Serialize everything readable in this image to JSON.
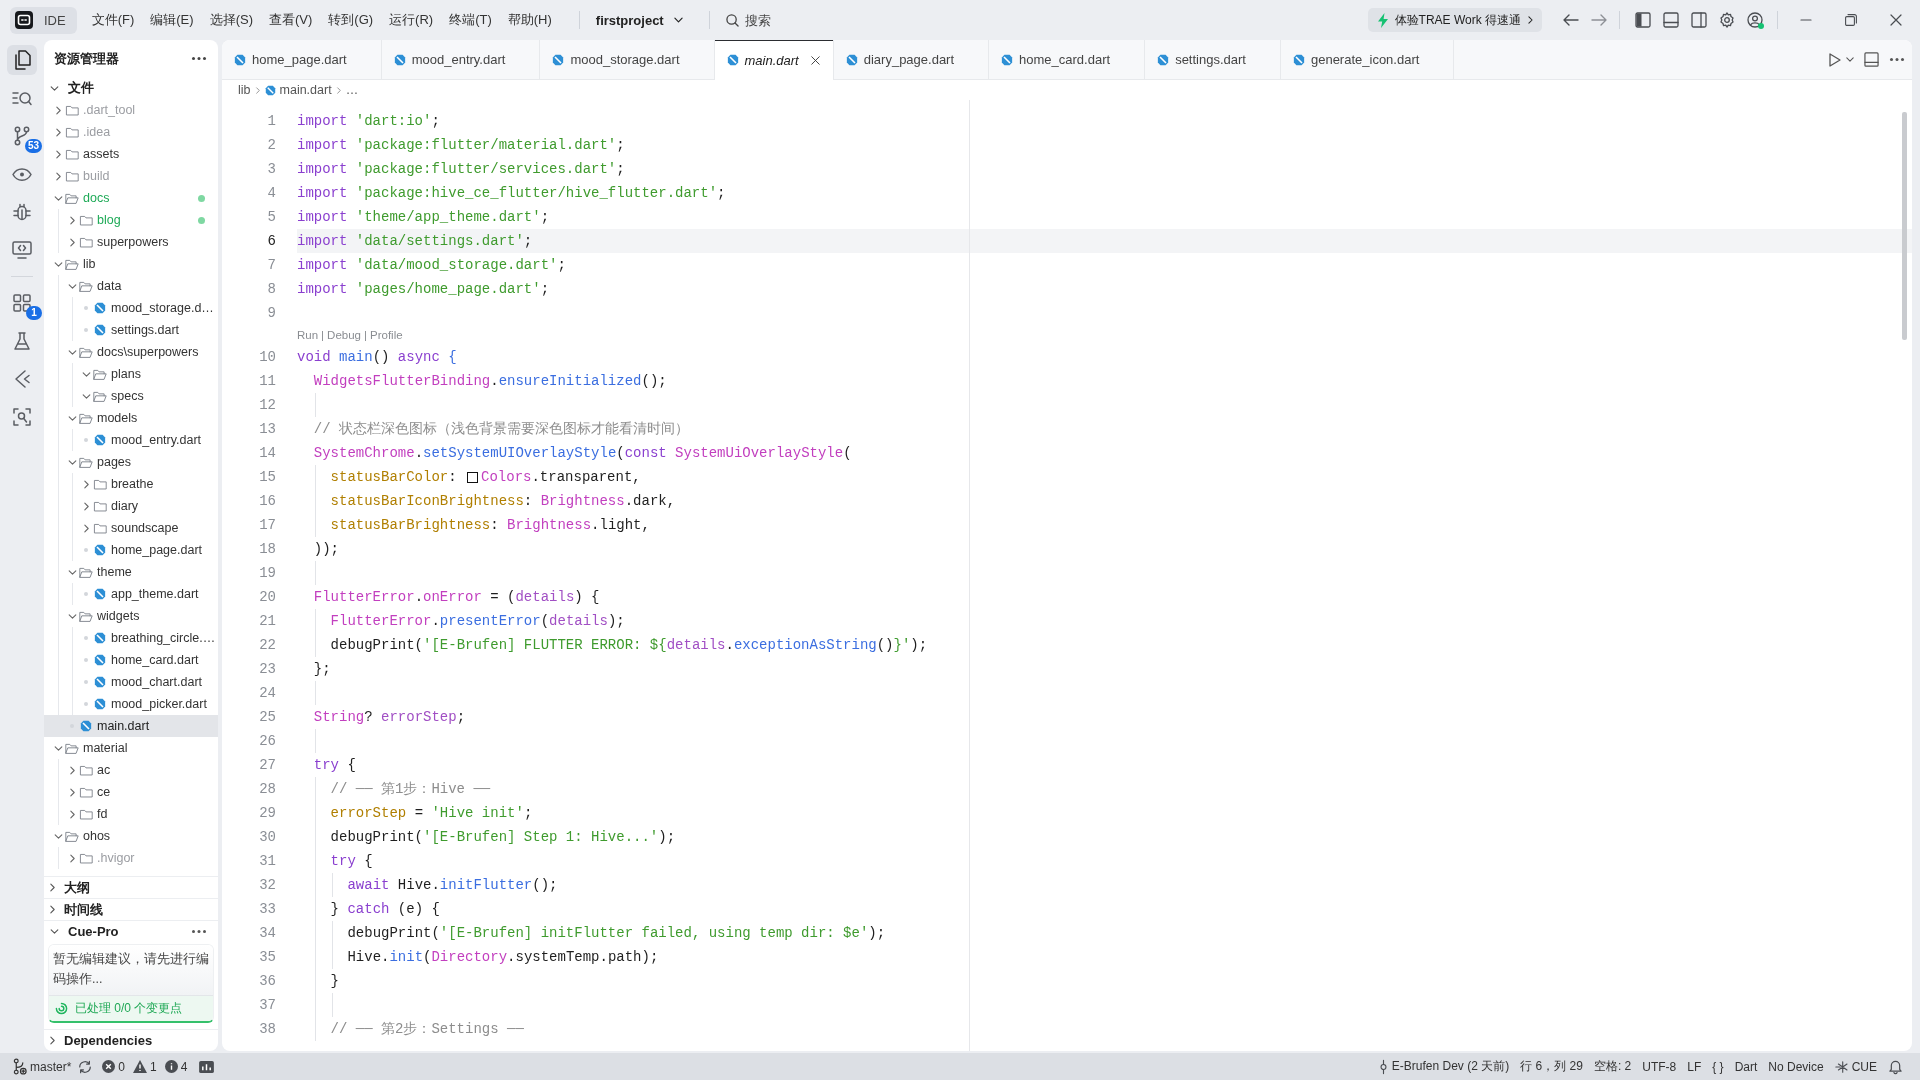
{
  "title_bar": {
    "app_name": "IDE",
    "menus": [
      "文件(F)",
      "编辑(E)",
      "选择(S)",
      "查看(V)",
      "转到(G)",
      "运行(R)",
      "终端(T)",
      "帮助(H)"
    ],
    "project": "firstproject",
    "search": {
      "placeholder": "搜索"
    },
    "promo": "体验TRAE Work 得速通"
  },
  "activity_bar": {
    "primary": [
      {
        "kind": "files",
        "selected": true
      },
      {
        "kind": "search",
        "selected": false
      },
      {
        "kind": "source-control",
        "selected": false,
        "badge": "53"
      },
      {
        "kind": "preview",
        "selected": false
      },
      {
        "kind": "debug",
        "selected": false
      },
      {
        "kind": "remote",
        "selected": false
      }
    ],
    "secondary": [
      {
        "kind": "extensions",
        "selected": false,
        "badge": "1"
      },
      {
        "kind": "testing",
        "selected": false
      },
      {
        "kind": "flutter",
        "selected": false
      },
      {
        "kind": "scan",
        "selected": false
      }
    ]
  },
  "explorer": {
    "title": "资源管理器",
    "section": {
      "title": "文件",
      "expanded": true
    },
    "tree": [
      {
        "label": ".dart_tool",
        "kind": "folder",
        "expanded": false,
        "ignored": true,
        "selected": false
      },
      {
        "label": ".idea",
        "kind": "folder",
        "expanded": false,
        "ignored": true,
        "selected": false
      },
      {
        "label": "assets",
        "kind": "folder",
        "expanded": false,
        "selected": false
      },
      {
        "label": "build",
        "kind": "folder",
        "expanded": false,
        "ignored": true,
        "selected": false
      },
      {
        "label": "docs",
        "kind": "folder",
        "expanded": true,
        "untracked": true,
        "selected": false,
        "children": [
          {
            "label": "blog",
            "kind": "folder",
            "expanded": false,
            "untracked": true,
            "selected": false
          },
          {
            "label": "superpowers",
            "kind": "folder",
            "expanded": false,
            "selected": false
          }
        ]
      },
      {
        "label": "lib",
        "kind": "folder",
        "expanded": true,
        "selected": false,
        "children": [
          {
            "label": "data",
            "kind": "folder",
            "expanded": true,
            "selected": false,
            "children": [
              {
                "label": "mood_storage.d…",
                "kind": "file",
                "selected": false
              },
              {
                "label": "settings.dart",
                "kind": "file",
                "selected": false
              }
            ]
          },
          {
            "label": "docs\\superpowers",
            "kind": "folder",
            "expanded": true,
            "selected": false,
            "children": [
              {
                "label": "plans",
                "kind": "folder",
                "expanded": true,
                "selected": false
              },
              {
                "label": "specs",
                "kind": "folder",
                "expanded": true,
                "selected": false
              }
            ]
          },
          {
            "label": "models",
            "kind": "folder",
            "expanded": true,
            "selected": false,
            "children": [
              {
                "label": "mood_entry.dart",
                "kind": "file",
                "selected": false
              }
            ]
          },
          {
            "label": "pages",
            "kind": "folder",
            "expanded": true,
            "selected": false,
            "children": [
              {
                "label": "breathe",
                "kind": "folder",
                "expanded": false,
                "selected": false
              },
              {
                "label": "diary",
                "kind": "folder",
                "expanded": false,
                "selected": false
              },
              {
                "label": "soundscape",
                "kind": "folder",
                "expanded": false,
                "selected": false
              },
              {
                "label": "home_page.dart",
                "kind": "file",
                "selected": false
              }
            ]
          },
          {
            "label": "theme",
            "kind": "folder",
            "expanded": true,
            "selected": false,
            "children": [
              {
                "label": "app_theme.dart",
                "kind": "file",
                "selected": false
              }
            ]
          },
          {
            "label": "widgets",
            "kind": "folder",
            "expanded": true,
            "selected": false,
            "children": [
              {
                "label": "breathing_circle.…",
                "kind": "file",
                "selected": false
              },
              {
                "label": "home_card.dart",
                "kind": "file",
                "selected": false
              },
              {
                "label": "mood_chart.dart",
                "kind": "file",
                "selected": false
              },
              {
                "label": "mood_picker.dart",
                "kind": "file",
                "selected": false
              }
            ]
          },
          {
            "label": "main.dart",
            "kind": "file",
            "selected": true
          }
        ]
      },
      {
        "label": "material",
        "kind": "folder",
        "expanded": true,
        "selected": false,
        "children": [
          {
            "label": "ac",
            "kind": "folder",
            "expanded": false,
            "selected": false
          },
          {
            "label": "ce",
            "kind": "folder",
            "expanded": false,
            "selected": false
          },
          {
            "label": "fd",
            "kind": "folder",
            "expanded": false,
            "selected": false
          }
        ]
      },
      {
        "label": "ohos",
        "kind": "folder",
        "expanded": true,
        "selected": false,
        "children": [
          {
            "label": ".hvigor",
            "kind": "folder",
            "expanded": false,
            "ignored": true,
            "selected": false
          }
        ]
      }
    ],
    "panels": [
      {
        "title": "大纲",
        "expanded": false
      },
      {
        "title": "时间线",
        "expanded": false
      },
      {
        "title": "Cue-Pro",
        "expanded": true,
        "message": "暂无编辑建议，请先进行编码操作...",
        "summary": "已处理 0/0 个变更点"
      },
      {
        "title": "Dependencies",
        "expanded": false
      }
    ]
  },
  "tabs": [
    {
      "label": "home_page.dart",
      "selected": false,
      "preview": false
    },
    {
      "label": "mood_entry.dart",
      "selected": false,
      "preview": false
    },
    {
      "label": "mood_storage.dart",
      "selected": false,
      "preview": false
    },
    {
      "label": "main.dart",
      "selected": true,
      "preview": true
    },
    {
      "label": "diary_page.dart",
      "selected": false,
      "preview": false
    },
    {
      "label": "home_card.dart",
      "selected": false,
      "preview": false
    },
    {
      "label": "settings.dart",
      "selected": false,
      "preview": false
    },
    {
      "label": "generate_icon.dart",
      "selected": false,
      "preview": false
    }
  ],
  "editor": {
    "breadcrumb": [
      {
        "kind": "folder",
        "label": "lib"
      },
      {
        "kind": "file",
        "label": "main.dart"
      },
      {
        "kind": "more",
        "label": "…"
      }
    ],
    "lines": [
      {
        "kind": "code",
        "n": "1",
        "current": false,
        "tokens": [
          {
            "kind": "keyword",
            "text": "import "
          },
          {
            "kind": "string",
            "text": "'dart:io'"
          },
          {
            "kind": "plain",
            "text": ";"
          }
        ]
      },
      {
        "kind": "code",
        "n": "2",
        "current": false,
        "tokens": [
          {
            "kind": "keyword",
            "text": "import "
          },
          {
            "kind": "string",
            "text": "'package:flutter/material.dart'"
          },
          {
            "kind": "plain",
            "text": ";"
          }
        ]
      },
      {
        "kind": "code",
        "n": "3",
        "current": false,
        "tokens": [
          {
            "kind": "keyword",
            "text": "import "
          },
          {
            "kind": "string",
            "text": "'package:flutter/services.dart'"
          },
          {
            "kind": "plain",
            "text": ";"
          }
        ]
      },
      {
        "kind": "code",
        "n": "4",
        "current": false,
        "tokens": [
          {
            "kind": "keyword",
            "text": "import "
          },
          {
            "kind": "string",
            "text": "'package:hive_ce_flutter/hive_flutter.dart'"
          },
          {
            "kind": "plain",
            "text": ";"
          }
        ]
      },
      {
        "kind": "code",
        "n": "5",
        "current": false,
        "tokens": [
          {
            "kind": "keyword",
            "text": "import "
          },
          {
            "kind": "string",
            "text": "'theme/app_theme.dart'"
          },
          {
            "kind": "plain",
            "text": ";"
          }
        ]
      },
      {
        "kind": "code",
        "n": "6",
        "current": true,
        "tokens": [
          {
            "kind": "keyword",
            "text": "import "
          },
          {
            "kind": "string",
            "text": "'data/settings.dart'"
          },
          {
            "kind": "plain",
            "text": ";"
          }
        ]
      },
      {
        "kind": "code",
        "n": "7",
        "current": false,
        "tokens": [
          {
            "kind": "keyword",
            "text": "import "
          },
          {
            "kind": "string",
            "text": "'data/mood_storage.dart'"
          },
          {
            "kind": "plain",
            "text": ";"
          }
        ]
      },
      {
        "kind": "code",
        "n": "8",
        "current": false,
        "tokens": [
          {
            "kind": "keyword",
            "text": "import "
          },
          {
            "kind": "string",
            "text": "'pages/home_page.dart'"
          },
          {
            "kind": "plain",
            "text": ";"
          }
        ]
      },
      {
        "kind": "code",
        "n": "9",
        "current": false
      },
      {
        "kind": "lens",
        "actions": [
          "Run",
          "Debug",
          "Profile"
        ],
        "separator": "|"
      },
      {
        "kind": "code",
        "n": "10",
        "current": false,
        "tokens": [
          {
            "kind": "keyword",
            "text": "void "
          },
          {
            "kind": "function",
            "text": "main"
          },
          {
            "kind": "plain",
            "text": "() "
          },
          {
            "kind": "keyword",
            "text": "async "
          },
          {
            "kind": "function",
            "text": "{"
          }
        ]
      },
      {
        "kind": "code",
        "n": "11",
        "current": false,
        "tokens": [
          {
            "kind": "type",
            "text": "  WidgetsFlutterBinding"
          },
          {
            "kind": "plain",
            "text": "."
          },
          {
            "kind": "function",
            "text": "ensureInitialized"
          },
          {
            "kind": "plain",
            "text": "();"
          }
        ]
      },
      {
        "kind": "code",
        "n": "12",
        "current": false
      },
      {
        "kind": "code",
        "n": "13",
        "current": false,
        "tokens": [
          {
            "kind": "comment",
            "text": "  // 状态栏深色图标（浅色背景需要深色图标才能看清时间）"
          }
        ]
      },
      {
        "kind": "code",
        "n": "14",
        "current": false,
        "tokens": [
          {
            "kind": "type",
            "text": "  SystemChrome"
          },
          {
            "kind": "plain",
            "text": "."
          },
          {
            "kind": "function",
            "text": "setSystemUIOverlayStyle"
          },
          {
            "kind": "plain",
            "text": "("
          },
          {
            "kind": "keyword",
            "text": "const "
          },
          {
            "kind": "type",
            "text": "SystemUiOverlayStyle"
          },
          {
            "kind": "plain",
            "text": "("
          }
        ]
      },
      {
        "kind": "code",
        "n": "15",
        "current": false,
        "tokens": [
          {
            "kind": "property",
            "text": "    statusBarColor"
          },
          {
            "kind": "plain",
            "text": ": "
          },
          {
            "kind": "swatch"
          },
          {
            "kind": "type",
            "text": "Colors"
          },
          {
            "kind": "plain",
            "text": ".transparent,"
          }
        ]
      },
      {
        "kind": "code",
        "n": "16",
        "current": false,
        "tokens": [
          {
            "kind": "property",
            "text": "    statusBarIconBrightness"
          },
          {
            "kind": "plain",
            "text": ": "
          },
          {
            "kind": "type",
            "text": "Brightness"
          },
          {
            "kind": "plain",
            "text": ".dark,"
          }
        ]
      },
      {
        "kind": "code",
        "n": "17",
        "current": false,
        "tokens": [
          {
            "kind": "property",
            "text": "    statusBarBrightness"
          },
          {
            "kind": "plain",
            "text": ": "
          },
          {
            "kind": "type",
            "text": "Brightness"
          },
          {
            "kind": "plain",
            "text": ".light,"
          }
        ]
      },
      {
        "kind": "code",
        "n": "18",
        "current": false,
        "tokens": [
          {
            "kind": "plain",
            "text": "  ));"
          }
        ]
      },
      {
        "kind": "code",
        "n": "19",
        "current": false
      },
      {
        "kind": "code",
        "n": "20",
        "current": false,
        "tokens": [
          {
            "kind": "type",
            "text": "  FlutterError"
          },
          {
            "kind": "plain",
            "text": "."
          },
          {
            "kind": "type",
            "text": "onError"
          },
          {
            "kind": "plain",
            "text": " = ("
          },
          {
            "kind": "param",
            "text": "details"
          },
          {
            "kind": "plain",
            "text": ") {"
          }
        ]
      },
      {
        "kind": "code",
        "n": "21",
        "current": false,
        "tokens": [
          {
            "kind": "type",
            "text": "    FlutterError"
          },
          {
            "kind": "plain",
            "text": "."
          },
          {
            "kind": "function",
            "text": "presentError"
          },
          {
            "kind": "plain",
            "text": "("
          },
          {
            "kind": "param",
            "text": "details"
          },
          {
            "kind": "plain",
            "text": ");"
          }
        ]
      },
      {
        "kind": "code",
        "n": "22",
        "current": false,
        "tokens": [
          {
            "kind": "plain",
            "text": "    debugPrint("
          },
          {
            "kind": "string",
            "text": "'[E-Brufen] FLUTTER ERROR: ${"
          },
          {
            "kind": "param",
            "text": "details"
          },
          {
            "kind": "plain",
            "text": "."
          },
          {
            "kind": "function",
            "text": "exceptionAsString"
          },
          {
            "kind": "plain",
            "text": "()"
          },
          {
            "kind": "string",
            "text": "}'"
          },
          {
            "kind": "plain",
            "text": ");"
          }
        ]
      },
      {
        "kind": "code",
        "n": "23",
        "current": false,
        "tokens": [
          {
            "kind": "plain",
            "text": "  };"
          }
        ]
      },
      {
        "kind": "code",
        "n": "24",
        "current": false
      },
      {
        "kind": "code",
        "n": "25",
        "current": false,
        "tokens": [
          {
            "kind": "type",
            "text": "  String"
          },
          {
            "kind": "plain",
            "text": "? "
          },
          {
            "kind": "param",
            "text": "errorStep"
          },
          {
            "kind": "plain",
            "text": ";"
          }
        ]
      },
      {
        "kind": "code",
        "n": "26",
        "current": false
      },
      {
        "kind": "code",
        "n": "27",
        "current": false,
        "tokens": [
          {
            "kind": "keyword",
            "text": "  try"
          },
          {
            "kind": "plain",
            "text": " {"
          }
        ]
      },
      {
        "kind": "code",
        "n": "28",
        "current": false,
        "tokens": [
          {
            "kind": "comment",
            "text": "    // ── 第1步：Hive ──"
          }
        ]
      },
      {
        "kind": "code",
        "n": "29",
        "current": false,
        "tokens": [
          {
            "kind": "property",
            "text": "    errorStep"
          },
          {
            "kind": "plain",
            "text": " = "
          },
          {
            "kind": "string",
            "text": "'Hive init'"
          },
          {
            "kind": "plain",
            "text": ";"
          }
        ]
      },
      {
        "kind": "code",
        "n": "30",
        "current": false,
        "tokens": [
          {
            "kind": "plain",
            "text": "    debugPrint("
          },
          {
            "kind": "string",
            "text": "'[E-Brufen] Step 1: Hive...'"
          },
          {
            "kind": "plain",
            "text": ");"
          }
        ]
      },
      {
        "kind": "code",
        "n": "31",
        "current": false,
        "tokens": [
          {
            "kind": "keyword",
            "text": "    try"
          },
          {
            "kind": "plain",
            "text": " {"
          }
        ]
      },
      {
        "kind": "code",
        "n": "32",
        "current": false,
        "tokens": [
          {
            "kind": "keyword",
            "text": "      await"
          },
          {
            "kind": "plain",
            "text": " Hive."
          },
          {
            "kind": "function",
            "text": "initFlutter"
          },
          {
            "kind": "plain",
            "text": "();"
          }
        ]
      },
      {
        "kind": "code",
        "n": "33",
        "current": false,
        "tokens": [
          {
            "kind": "plain",
            "text": "    } "
          },
          {
            "kind": "keyword",
            "text": "catch"
          },
          {
            "kind": "plain",
            "text": " (e) {"
          }
        ]
      },
      {
        "kind": "code",
        "n": "34",
        "current": false,
        "tokens": [
          {
            "kind": "plain",
            "text": "      debugPrint("
          },
          {
            "kind": "string",
            "text": "'[E-Brufen] initFlutter failed, using temp dir: $e'"
          },
          {
            "kind": "plain",
            "text": ");"
          }
        ]
      },
      {
        "kind": "code",
        "n": "35",
        "current": false,
        "tokens": [
          {
            "kind": "plain",
            "text": "      Hive."
          },
          {
            "kind": "function",
            "text": "init"
          },
          {
            "kind": "plain",
            "text": "("
          },
          {
            "kind": "type",
            "text": "Directory"
          },
          {
            "kind": "plain",
            "text": ".systemTemp.path);"
          }
        ]
      },
      {
        "kind": "code",
        "n": "36",
        "current": false,
        "tokens": [
          {
            "kind": "plain",
            "text": "    }"
          }
        ]
      },
      {
        "kind": "code",
        "n": "37",
        "current": false
      },
      {
        "kind": "code",
        "n": "38",
        "current": false,
        "tokens": [
          {
            "kind": "comment",
            "text": "    // ── 第2步：Settings ──"
          }
        ]
      }
    ]
  },
  "status_bar": {
    "branch": "master*",
    "errors": "0",
    "warnings": "1",
    "infos": "4",
    "items": [
      {
        "kind": "commit",
        "text": "E-Brufen Dev (2 天前)"
      },
      {
        "kind": "text",
        "text": "行 6，列 29"
      },
      {
        "kind": "text",
        "text": "空格: 2"
      },
      {
        "kind": "text",
        "text": "UTF-8"
      },
      {
        "kind": "text",
        "text": "LF"
      },
      {
        "kind": "text",
        "text": "{ }"
      },
      {
        "kind": "text",
        "text": "Dart"
      },
      {
        "kind": "text",
        "text": "No Device"
      },
      {
        "kind": "cue",
        "text": "CUE"
      }
    ]
  }
}
